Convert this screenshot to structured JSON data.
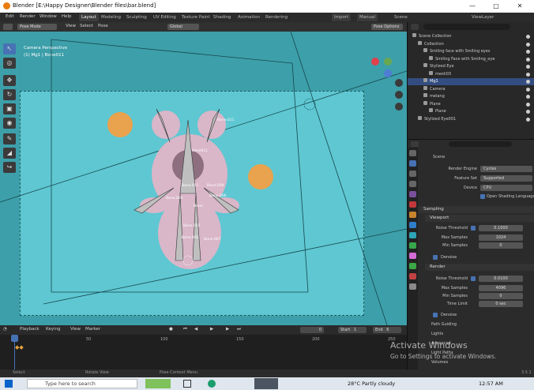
{
  "window": {
    "title": "Blender [E:\\Happy Designer\\Blender files\\bar.blend]"
  },
  "menu": {
    "items": [
      "Edit",
      "Render",
      "Window",
      "Help"
    ]
  },
  "workspaces": [
    "Layout",
    "Modeling",
    "Sculpting",
    "UV Editing",
    "Texture Paint",
    "Shading",
    "Animation",
    "Rendering"
  ],
  "topright": {
    "import": "Import",
    "manual": "Manual",
    "scene": "Scene",
    "viewlayer": "ViewLayer"
  },
  "viewport_header": {
    "mode": "Pose Mode",
    "view": "View",
    "select": "Select",
    "pose": "Pose",
    "orientation": "Global",
    "pose_options": "Pose Options"
  },
  "viewport": {
    "line1": "Camera Perspective",
    "line2": "(1) Mg1 | Bone011"
  },
  "bones": [
    "Bone.011",
    "Bone011",
    "Bone.001",
    "Bone.004",
    "Bone.006",
    "Bone",
    "Bone.003",
    "Bone.005",
    "Bone.002",
    "Bone.007"
  ],
  "timeline": {
    "playback": "Playback",
    "keying": "Keying",
    "view": "View",
    "marker": "Marker",
    "current": "0",
    "start_label": "Start",
    "start": "1",
    "end_label": "End",
    "end": "6",
    "ticks": [
      "0",
      "50",
      "100",
      "150",
      "200",
      "250"
    ]
  },
  "statusbar": {
    "select": "Select",
    "rotate": "Rotate View",
    "context": "Pose Context Menu",
    "version": "3.5.1"
  },
  "taskbar": {
    "search": "Type here to search",
    "weather": "28°C  Partly cloudy",
    "time": "12:57 AM"
  },
  "outliner": {
    "rows": [
      {
        "label": "Scene Collection",
        "indent": 0,
        "selected": false
      },
      {
        "label": "Collection",
        "indent": 1,
        "selected": false
      },
      {
        "label": "Smiling face with Smiling eyes",
        "indent": 2,
        "selected": false
      },
      {
        "label": "Smiling Face with Smiling_eye",
        "indent": 3,
        "selected": false
      },
      {
        "label": "Stylized Eye",
        "indent": 2,
        "selected": false
      },
      {
        "label": "mesh03",
        "indent": 3,
        "selected": false
      },
      {
        "label": "Mg1",
        "indent": 2,
        "selected": true
      },
      {
        "label": "Camera",
        "indent": 2,
        "selected": false
      },
      {
        "label": "melang",
        "indent": 2,
        "selected": false
      },
      {
        "label": "Plane",
        "indent": 2,
        "selected": false
      },
      {
        "label": "Plane",
        "indent": 3,
        "selected": false
      },
      {
        "label": "Stylized Eye001",
        "indent": 1,
        "selected": false
      }
    ]
  },
  "properties": {
    "search_placeholder": "",
    "scene": "Scene",
    "render_engine_label": "Render Engine",
    "render_engine": "Cycles",
    "feature_set_label": "Feature Set",
    "feature_set": "Supported",
    "device_label": "Device",
    "device": "CPU",
    "open_shading": "Open Shading Language",
    "sampling": "Sampling",
    "viewport": "Viewport",
    "noise_threshold_label": "Noise Threshold",
    "viewport_noise": "0.1000",
    "max_samples_label": "Max Samples",
    "viewport_max": "1024",
    "min_samples_label": "Min Samples",
    "viewport_min": "0",
    "denoise": "Denoise",
    "render": "Render",
    "render_noise": "0.0100",
    "render_max": "4096",
    "render_min": "0",
    "time_limit_label": "Time Limit",
    "time_limit": "0 sec",
    "denoise2": "Denoise",
    "path_guiding": "Path Guiding",
    "lights": "Lights",
    "advanced": "Advanced",
    "light_paths": "Light Paths",
    "volumes": "Volumes"
  },
  "watermark": {
    "line1": "Activate Windows",
    "line2": "Go to Settings to activate Windows."
  },
  "colors": {
    "viewport_bg": "#3d9faa",
    "camera_bg": "#5ec7d2",
    "accent": "#4772b3",
    "ball": "#e9a24e"
  }
}
